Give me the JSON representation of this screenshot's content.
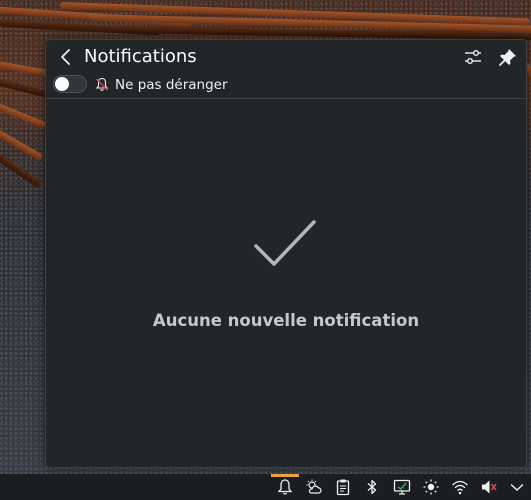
{
  "panel": {
    "title": "Notifications",
    "dnd_label": "Ne pas déranger",
    "dnd_enabled": false,
    "empty_message": "Aucune nouvelle notification"
  },
  "icons": {
    "back": "back-arrow-icon",
    "configure": "configure-sliders-icon",
    "pin": "pin-icon",
    "dnd": "bell-slash-icon",
    "empty_state": "checkmark-icon"
  },
  "taskbar": {
    "tray": [
      "notifications-bell-icon",
      "weather-icon",
      "clipboard-icon",
      "bluetooth-icon",
      "display-configuration-icon",
      "brightness-icon",
      "wifi-icon",
      "volume-muted-icon",
      "expand-tray-icon"
    ],
    "active": "notifications-bell-icon"
  },
  "colors": {
    "panel_bg": "#232629",
    "text": "#fcfcfc",
    "muted_text": "#c6c8ca",
    "accent": "#e8a33c",
    "taskbar_bg": "#1b1e20"
  }
}
